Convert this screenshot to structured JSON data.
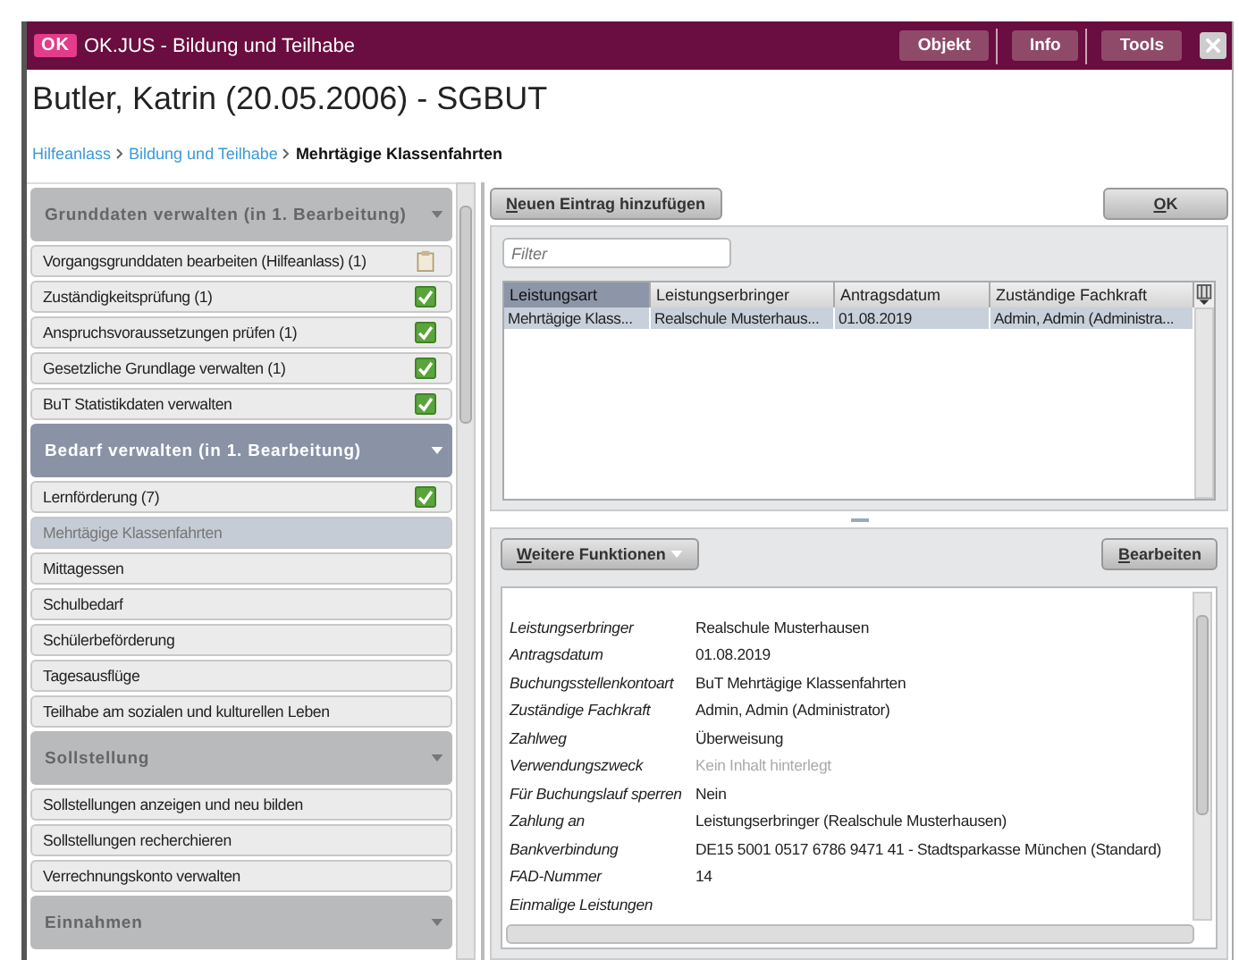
{
  "window": {
    "logo": "OK",
    "title": "OK.JUS - Bildung und Teilhabe",
    "menu": [
      "Objekt",
      "Info",
      "Tools"
    ]
  },
  "person": "Butler, Katrin (20.05.2006) - SGBUT",
  "breadcrumb": [
    {
      "label": "Hilfeanlass",
      "current": false
    },
    {
      "label": "Bildung und Teilhabe",
      "current": false
    },
    {
      "label": "Mehrtägige Klassenfahrten",
      "current": true
    }
  ],
  "sidebar": {
    "sections": [
      {
        "title": "Grunddaten verwalten (in 1. Bearbeitung)",
        "selected": false,
        "items": [
          {
            "label": "Vorgangsgrunddaten bearbeiten (Hilfeanlass) (1)",
            "kind": "clipboard",
            "selected": false
          },
          {
            "label": "Zuständigkeitsprüfung (1)",
            "kind": "done",
            "selected": false
          },
          {
            "label": "Anspruchsvoraussetzungen prüfen (1)",
            "kind": "done",
            "selected": false
          },
          {
            "label": "Gesetzliche Grundlage verwalten (1)",
            "kind": "done",
            "selected": false
          },
          {
            "label": "BuT Statistikdaten verwalten",
            "kind": "done",
            "selected": false
          }
        ]
      },
      {
        "title": "Bedarf verwalten (in 1. Bearbeitung)",
        "selected": true,
        "items": [
          {
            "label": "Lernförderung (7)",
            "kind": "done",
            "selected": false
          },
          {
            "label": "Mehrtägige Klassenfahrten",
            "kind": "plain",
            "selected": true
          },
          {
            "label": "Mittagessen",
            "kind": "plain",
            "selected": false
          },
          {
            "label": "Schulbedarf",
            "kind": "plain",
            "selected": false
          },
          {
            "label": "Schülerbeförderung",
            "kind": "plain",
            "selected": false
          },
          {
            "label": "Tagesausflüge",
            "kind": "plain",
            "selected": false
          },
          {
            "label": "Teilhabe am sozialen und kulturellen Leben",
            "kind": "plain",
            "selected": false
          }
        ]
      },
      {
        "title": "Sollstellung",
        "selected": false,
        "items": [
          {
            "label": "Sollstellungen anzeigen und neu bilden",
            "kind": "plain",
            "selected": false
          },
          {
            "label": "Sollstellungen recherchieren",
            "kind": "plain",
            "selected": false
          },
          {
            "label": "Verrechnungskonto verwalten",
            "kind": "plain",
            "selected": false
          }
        ]
      },
      {
        "title": "Einnahmen",
        "selected": false
      }
    ]
  },
  "toolbar": {
    "add_button": "Neuen Eintrag hinzufügen",
    "ok_button": "OK"
  },
  "filter": {
    "placeholder": "Filter"
  },
  "table": {
    "columns": [
      {
        "label": "Leistungsart",
        "selected": true
      },
      {
        "label": "Leistungserbringer",
        "selected": false
      },
      {
        "label": "Antragsdatum",
        "selected": false
      },
      {
        "label": "Zuständige Fachkraft",
        "selected": false
      }
    ],
    "rows": [
      {
        "cells": [
          "Mehrtägige Klass...",
          "Realschule Musterhaus...",
          "01.08.2019",
          "Admin, Admin (Administra..."
        ],
        "selected": true
      }
    ]
  },
  "detail": {
    "more_button": "Weitere Funktionen",
    "edit_button": "Bearbeiten",
    "fields": [
      {
        "label": "Leistungserbringer",
        "value": "Realschule Musterhausen",
        "muted": false
      },
      {
        "label": "Antragsdatum",
        "value": "01.08.2019",
        "muted": false
      },
      {
        "label": "Buchungsstellenkontoart",
        "value": "BuT Mehrtägige Klassenfahrten",
        "muted": false
      },
      {
        "label": "Zuständige Fachkraft",
        "value": "Admin, Admin (Administrator)",
        "muted": false
      },
      {
        "label": "Zahlweg",
        "value": "Überweisung",
        "muted": false
      },
      {
        "label": "Verwendungszweck",
        "value": "Kein Inhalt hinterlegt",
        "muted": true
      },
      {
        "label": "Für Buchungslauf sperren",
        "value": "Nein",
        "muted": false
      },
      {
        "label": "Zahlung an",
        "value": "Leistungserbringer (Realschule Musterhausen)",
        "muted": false
      },
      {
        "label": "Bankverbindung",
        "value": "DE15 5001 0517 6786 9471 41 - Stadtsparkasse München (Standard)",
        "muted": false
      },
      {
        "label": "FAD-Nummer",
        "value": "14",
        "muted": false
      },
      {
        "label": "Einmalige Leistungen"
      }
    ]
  }
}
